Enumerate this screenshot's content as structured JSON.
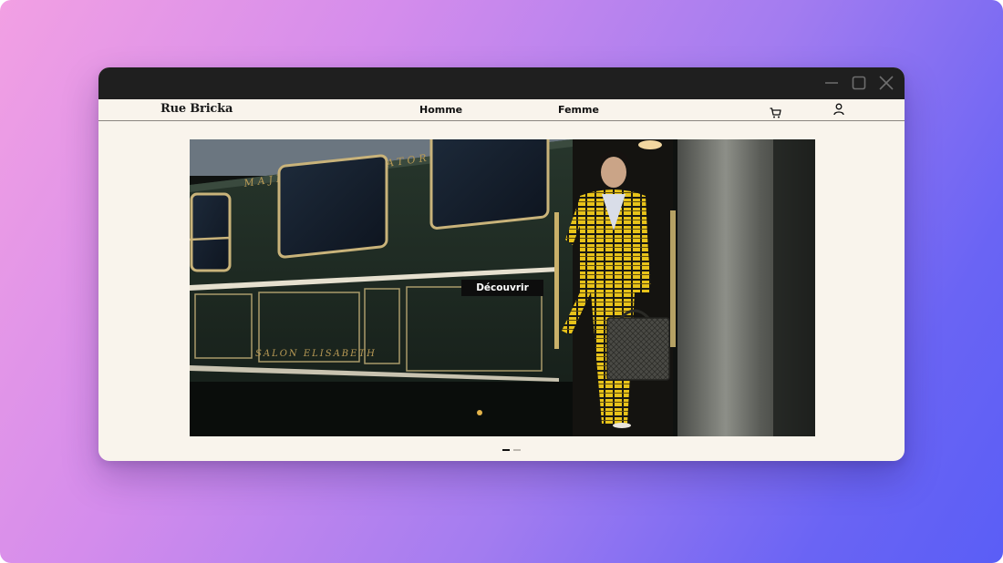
{
  "brand": {
    "name": "Rue Bricka"
  },
  "nav": {
    "items": [
      {
        "label": "Homme"
      },
      {
        "label": "Femme"
      }
    ]
  },
  "icons": {
    "cart": "cart-icon",
    "account": "user-icon"
  },
  "window_controls": [
    "minimize-icon",
    "maximize-icon",
    "close-icon"
  ],
  "hero": {
    "cta_label": "Découvrir",
    "train_lettering_top": "MAJESTIC IMPERATOR",
    "train_lettering_bottom": "SALON ELISABETH"
  },
  "carousel": {
    "slide_count": 2,
    "active_index": 0
  },
  "colors": {
    "page_background": "#f9f4ec",
    "titlebar": "#1f1f1f",
    "cta_background": "#0d0d0d",
    "train_green": "#1d2a22",
    "suit_yellow": "#e8c31a"
  }
}
